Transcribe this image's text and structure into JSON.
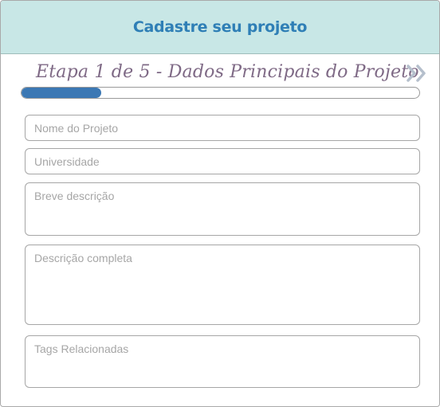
{
  "header": {
    "title": "Cadastre seu projeto"
  },
  "step": {
    "title": "Etapa 1 de 5 - Dados Principais do Projeto",
    "current": 1,
    "total": 5,
    "progress_fraction": 0.2,
    "next_icon": "double-chevron-right-icon"
  },
  "form": {
    "nome": {
      "placeholder": "Nome do Projeto",
      "value": ""
    },
    "universidade": {
      "placeholder": "Universidade",
      "value": ""
    },
    "breve": {
      "placeholder": "Breve descrição",
      "value": ""
    },
    "completa": {
      "placeholder": "Descrição completa",
      "value": ""
    },
    "tags": {
      "placeholder": "Tags Relacionadas",
      "value": ""
    }
  },
  "colors": {
    "header_bg": "#c8e7e6",
    "header_text": "#2f7fb6",
    "step_text": "#7f6a86",
    "progress_fill": "#3c78b4",
    "chevron": "#b5bfcc"
  }
}
